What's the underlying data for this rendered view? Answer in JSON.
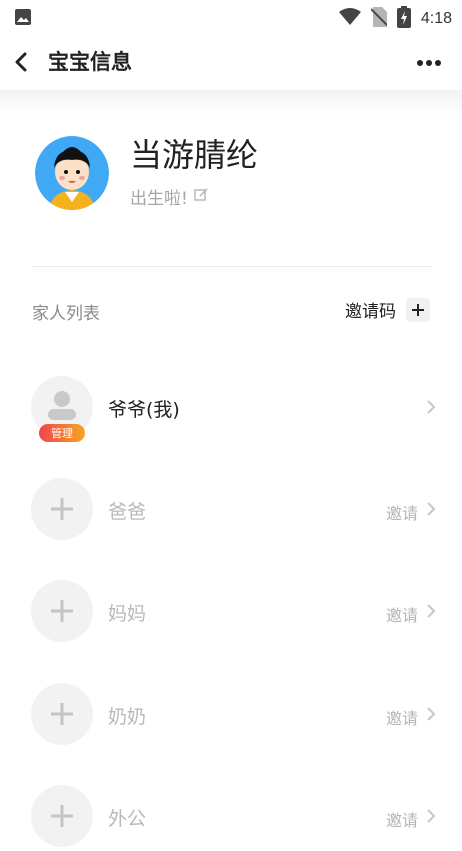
{
  "status_bar": {
    "time": "4:18",
    "icons": [
      "image-icon",
      "wifi-icon",
      "no-sim-icon",
      "battery-charging-icon"
    ]
  },
  "header": {
    "title": "宝宝信息",
    "back_icon": "chevron-left-icon",
    "more_icon": "more-horizontal-icon"
  },
  "profile": {
    "name": "当游腈纶",
    "status": "出生啦!",
    "edit_icon": "edit-icon"
  },
  "family": {
    "section_title": "家人列表",
    "invite_code_label": "邀请码",
    "members": [
      {
        "name": "爷爷(我)",
        "badge": "管理",
        "action": ""
      },
      {
        "name": "爸爸",
        "badge": "",
        "action": "邀请"
      },
      {
        "name": "妈妈",
        "badge": "",
        "action": "邀请"
      },
      {
        "name": "奶奶",
        "badge": "",
        "action": "邀请"
      },
      {
        "name": "外公",
        "badge": "",
        "action": "邀请"
      }
    ]
  },
  "colors": {
    "badge_gradient_start": "#f0444f",
    "badge_gradient_end": "#f5a623",
    "avatar_bg": "#3fa9f5"
  }
}
